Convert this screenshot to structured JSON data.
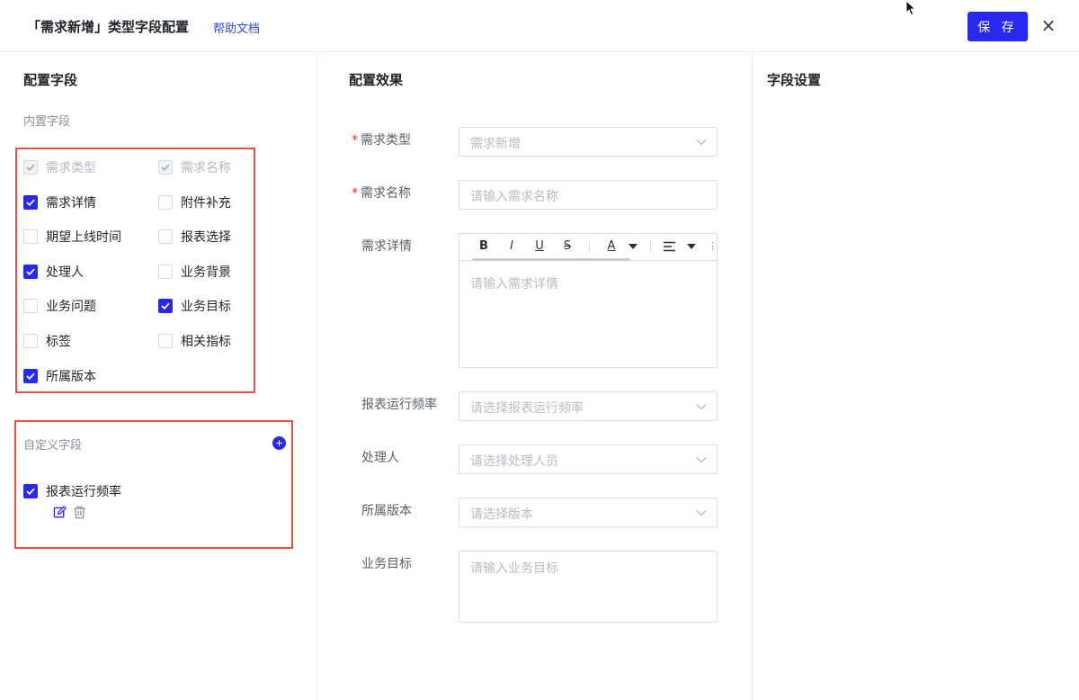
{
  "header": {
    "title": "「需求新增」类型字段配置",
    "help_link": "帮助文档",
    "save_label": "保 存",
    "close_glyph": "×"
  },
  "left": {
    "title": "配置字段",
    "builtin_title": "内置字段",
    "builtin_fields": [
      {
        "label": "需求类型",
        "checked": true,
        "disabled": true
      },
      {
        "label": "需求名称",
        "checked": true,
        "disabled": true
      },
      {
        "label": "需求详情",
        "checked": true,
        "disabled": false
      },
      {
        "label": "附件补充",
        "checked": false,
        "disabled": false
      },
      {
        "label": "期望上线时间",
        "checked": false,
        "disabled": false
      },
      {
        "label": "报表选择",
        "checked": false,
        "disabled": false
      },
      {
        "label": "处理人",
        "checked": true,
        "disabled": false
      },
      {
        "label": "业务背景",
        "checked": false,
        "disabled": false
      },
      {
        "label": "业务问题",
        "checked": false,
        "disabled": false
      },
      {
        "label": "业务目标",
        "checked": true,
        "disabled": false
      },
      {
        "label": "标签",
        "checked": false,
        "disabled": false
      },
      {
        "label": "相关指标",
        "checked": false,
        "disabled": false
      },
      {
        "label": "所属版本",
        "checked": true,
        "disabled": false
      }
    ],
    "custom_title": "自定义字段",
    "custom_fields": [
      {
        "label": "报表运行频率",
        "checked": true
      }
    ]
  },
  "middle": {
    "title": "配置效果",
    "fields": {
      "type": {
        "label": "需求类型",
        "required": true,
        "placeholder": "需求新增"
      },
      "name": {
        "label": "需求名称",
        "required": true,
        "placeholder": "请输入需求名称"
      },
      "detail": {
        "label": "需求详情",
        "required": false,
        "placeholder": "请输入需求详情"
      },
      "freq": {
        "label": "报表运行频率",
        "required": false,
        "placeholder": "请选择报表运行频率"
      },
      "handler": {
        "label": "处理人",
        "required": false,
        "placeholder": "请选择处理人员"
      },
      "version": {
        "label": "所属版本",
        "required": false,
        "placeholder": "请选择版本"
      },
      "goal": {
        "label": "业务目标",
        "required": false,
        "placeholder": "请输入业务目标"
      }
    },
    "required_mark": "*",
    "toolbar": {
      "bold": "B",
      "italic": "I",
      "underline": "U",
      "strike": "S",
      "font_color": "A",
      "more": "⋮"
    }
  },
  "right": {
    "title": "字段设置"
  },
  "colors": {
    "accent": "#2828f0",
    "highlight_border": "#e25340",
    "required": "#e53935",
    "link": "#2a4bf0"
  }
}
